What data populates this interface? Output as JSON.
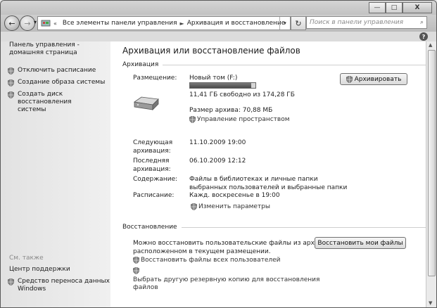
{
  "window": {
    "minimize": "—",
    "maximize": "□",
    "close": "X"
  },
  "nav": {
    "back": "←",
    "forward": "→",
    "recent": "▾"
  },
  "address": {
    "crumb1": "Все элементы панели управления",
    "crumb2": "Архивация и восстановление",
    "dropdown": "▾",
    "refresh": "↻"
  },
  "search": {
    "placeholder": "Поиск в панели управления",
    "icon": "⌕"
  },
  "help": "?",
  "sidebar": {
    "home": "Панель управления -\nдомашняя страница",
    "items": [
      "Отключить расписание",
      "Создание образа системы",
      "Создать диск восстановления\nсистемы"
    ],
    "see_also": "См. также",
    "see_also_items": [
      "Центр поддержки",
      "Средство переноса данных\nWindows"
    ]
  },
  "main": {
    "title": "Архивация или восстановление файлов",
    "backup": {
      "section": "Архивация",
      "location_label": "Размещение:",
      "volume": "Новый том (F:)",
      "disk_usage_fraction": 0.934,
      "free_space": "11,41 ГБ свободно из 174,28 ГБ",
      "archive_size": "Размер архива: 70,88 МБ",
      "manage_space": "Управление пространством",
      "backup_now": "Архивировать",
      "next_label": "Следующая\nархивация:",
      "next_value": "11.10.2009 19:00",
      "last_label": "Последняя\nархивация:",
      "last_value": "06.10.2009 12:12",
      "contents_label": "Содержание:",
      "contents_value": "Файлы в библиотеках и личные папки\nвыбранных пользователей и выбранные папки",
      "schedule_label": "Расписание:",
      "schedule_value": "Кажд. воскресенье в 19:00",
      "change_settings": "Изменить параметры"
    },
    "restore": {
      "section": "Восстановление",
      "desc": "Можно восстановить пользовательские файлы из архива,\nрасположенном в текущем размещении.",
      "restore_my_files": "Восстановить мои файлы",
      "restore_all_users": "Восстановить файлы всех пользователей",
      "select_another": "Выбрать другую резервную копию для восстановления\nфайлов"
    }
  }
}
